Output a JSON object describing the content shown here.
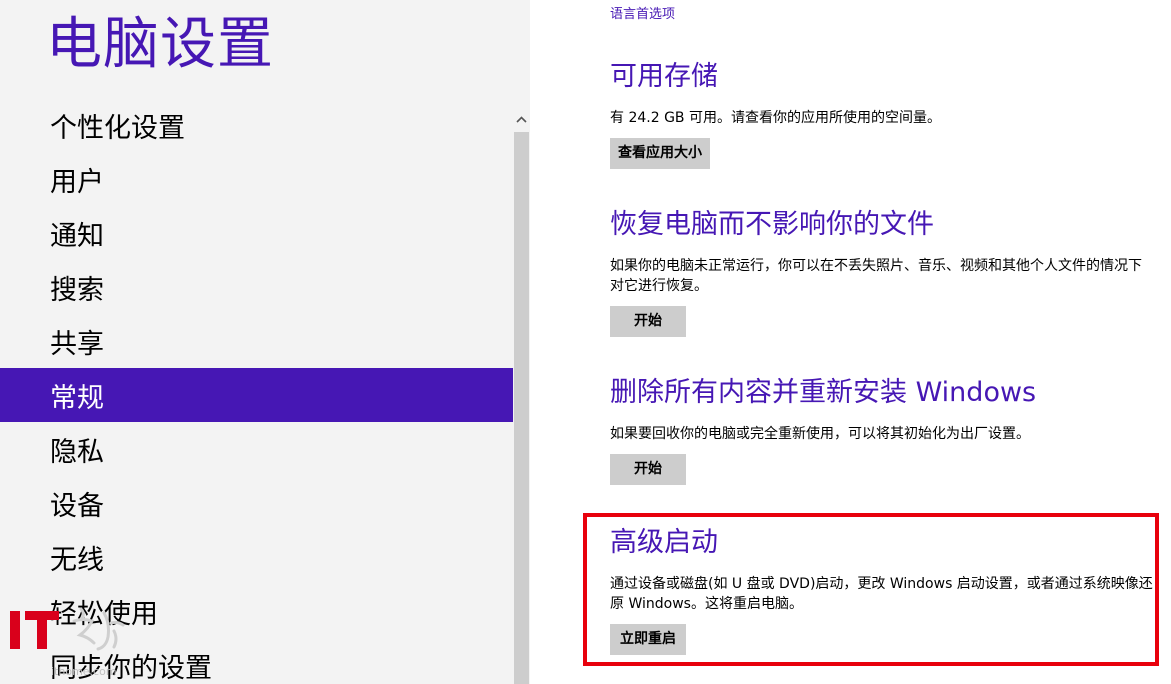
{
  "app": {
    "title": "电脑设置"
  },
  "nav": {
    "items": [
      {
        "label": "个性化设置"
      },
      {
        "label": "用户"
      },
      {
        "label": "通知"
      },
      {
        "label": "搜索"
      },
      {
        "label": "共享"
      },
      {
        "label": "常规",
        "selected": true
      },
      {
        "label": "隐私"
      },
      {
        "label": "设备"
      },
      {
        "label": "无线"
      },
      {
        "label": "轻松使用"
      },
      {
        "label": "同步你的设置"
      }
    ]
  },
  "main": {
    "language_link": "语言首选项",
    "sections": [
      {
        "title": "可用存储",
        "description": "有 24.2 GB 可用。请查看你的应用所使用的空间量。",
        "button": "查看应用大小"
      },
      {
        "title": "恢复电脑而不影响你的文件",
        "description": "如果你的电脑未正常运行，你可以在不丢失照片、音乐、视频和其他个人文件的情况下对它进行恢复。",
        "button": "开始"
      },
      {
        "title": "删除所有内容并重新安装 Windows",
        "description": "如果要回收你的电脑或完全重新使用，可以将其初始化为出厂设置。",
        "button": "开始"
      },
      {
        "title": "高级启动",
        "description": "通过设备或磁盘(如 U 盘或 DVD)启动，更改 Windows 启动设置，或者通过系统映像还原 Windows。这将重启电脑。",
        "button": "立即重启"
      }
    ]
  },
  "watermark": {
    "logo_text": "IT之家",
    "url": "ithome.com"
  },
  "colors": {
    "accent": "#4617b4",
    "highlight": "#e8000c",
    "button_bg": "#cdcdcd",
    "left_bg": "#f3f3f3"
  }
}
